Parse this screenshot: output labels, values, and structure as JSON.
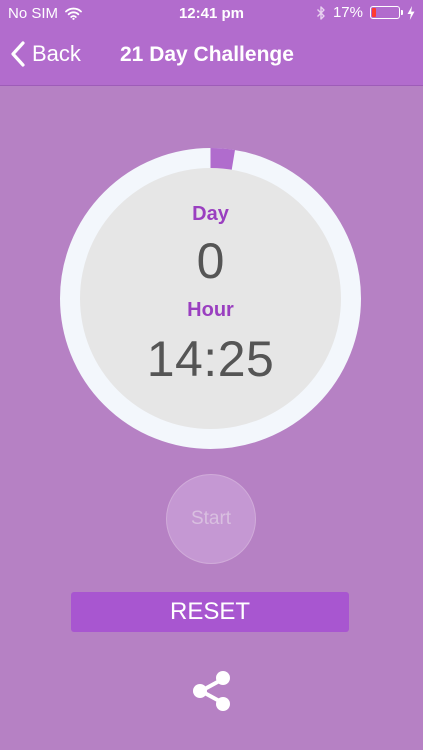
{
  "status_bar": {
    "carrier": "No SIM",
    "time": "12:41 pm",
    "battery_percent": "17%",
    "battery_level": 0.17,
    "battery_color": "#ff3b30",
    "icons": [
      "wifi-icon",
      "bluetooth-icon",
      "battery-icon",
      "charging-bolt-icon"
    ]
  },
  "nav": {
    "back_label": "Back",
    "title": "21 Day Challenge"
  },
  "timer": {
    "day_label": "Day",
    "day_value": "0",
    "hour_label": "Hour",
    "hour_value": "14:25",
    "progress_fraction": 0.026,
    "progress_color": "#b06ccd"
  },
  "controls": {
    "start_label": "Start",
    "reset_label": "RESET",
    "share_icon": "share-icon"
  },
  "colors": {
    "background": "#b681c4",
    "header": "#b26ccd",
    "accent_text": "#9a3fc0",
    "reset_button": "#a856d0"
  }
}
